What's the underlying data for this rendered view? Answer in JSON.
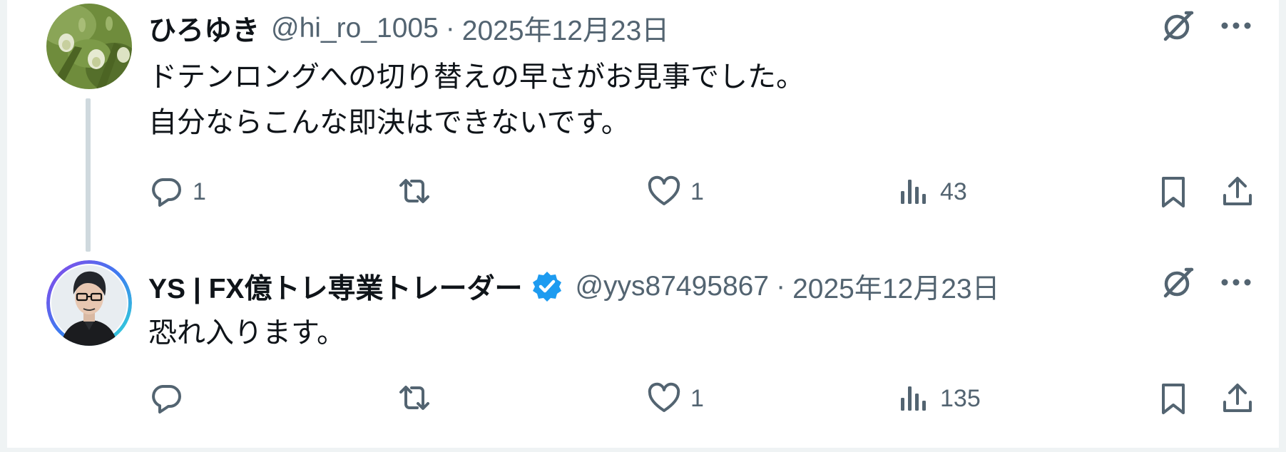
{
  "colors": {
    "text_primary": "#0f1419",
    "text_secondary": "#536471",
    "thread_line": "#cfd9de",
    "verified": "#1d9bf0",
    "border": "#eff3f4"
  },
  "posts": [
    {
      "display_name": "ひろゆき",
      "handle": "@hi_ro_1005",
      "separator": "·",
      "date": "2025年12月23日",
      "verified": false,
      "lines": [
        "ドテンロングへの切り替えの早さがお見事でした。",
        "自分ならこんな即決はできないです。"
      ],
      "actions": {
        "reply_count": "1",
        "repost_count": "",
        "like_count": "1",
        "views_count": "43"
      },
      "icons": [
        "grok-icon",
        "more-icon",
        "reply-icon",
        "repost-icon",
        "like-icon",
        "views-icon",
        "bookmark-icon",
        "share-icon"
      ]
    },
    {
      "display_name": "YS | FX億トレ専業トレーダー",
      "handle": "@yys87495867",
      "separator": "·",
      "date": "2025年12月23日",
      "verified": true,
      "lines": [
        "恐れ入ります。"
      ],
      "actions": {
        "reply_count": "",
        "repost_count": "",
        "like_count": "1",
        "views_count": "135"
      },
      "icons": [
        "grok-icon",
        "more-icon",
        "reply-icon",
        "repost-icon",
        "like-icon",
        "views-icon",
        "bookmark-icon",
        "share-icon"
      ]
    }
  ]
}
